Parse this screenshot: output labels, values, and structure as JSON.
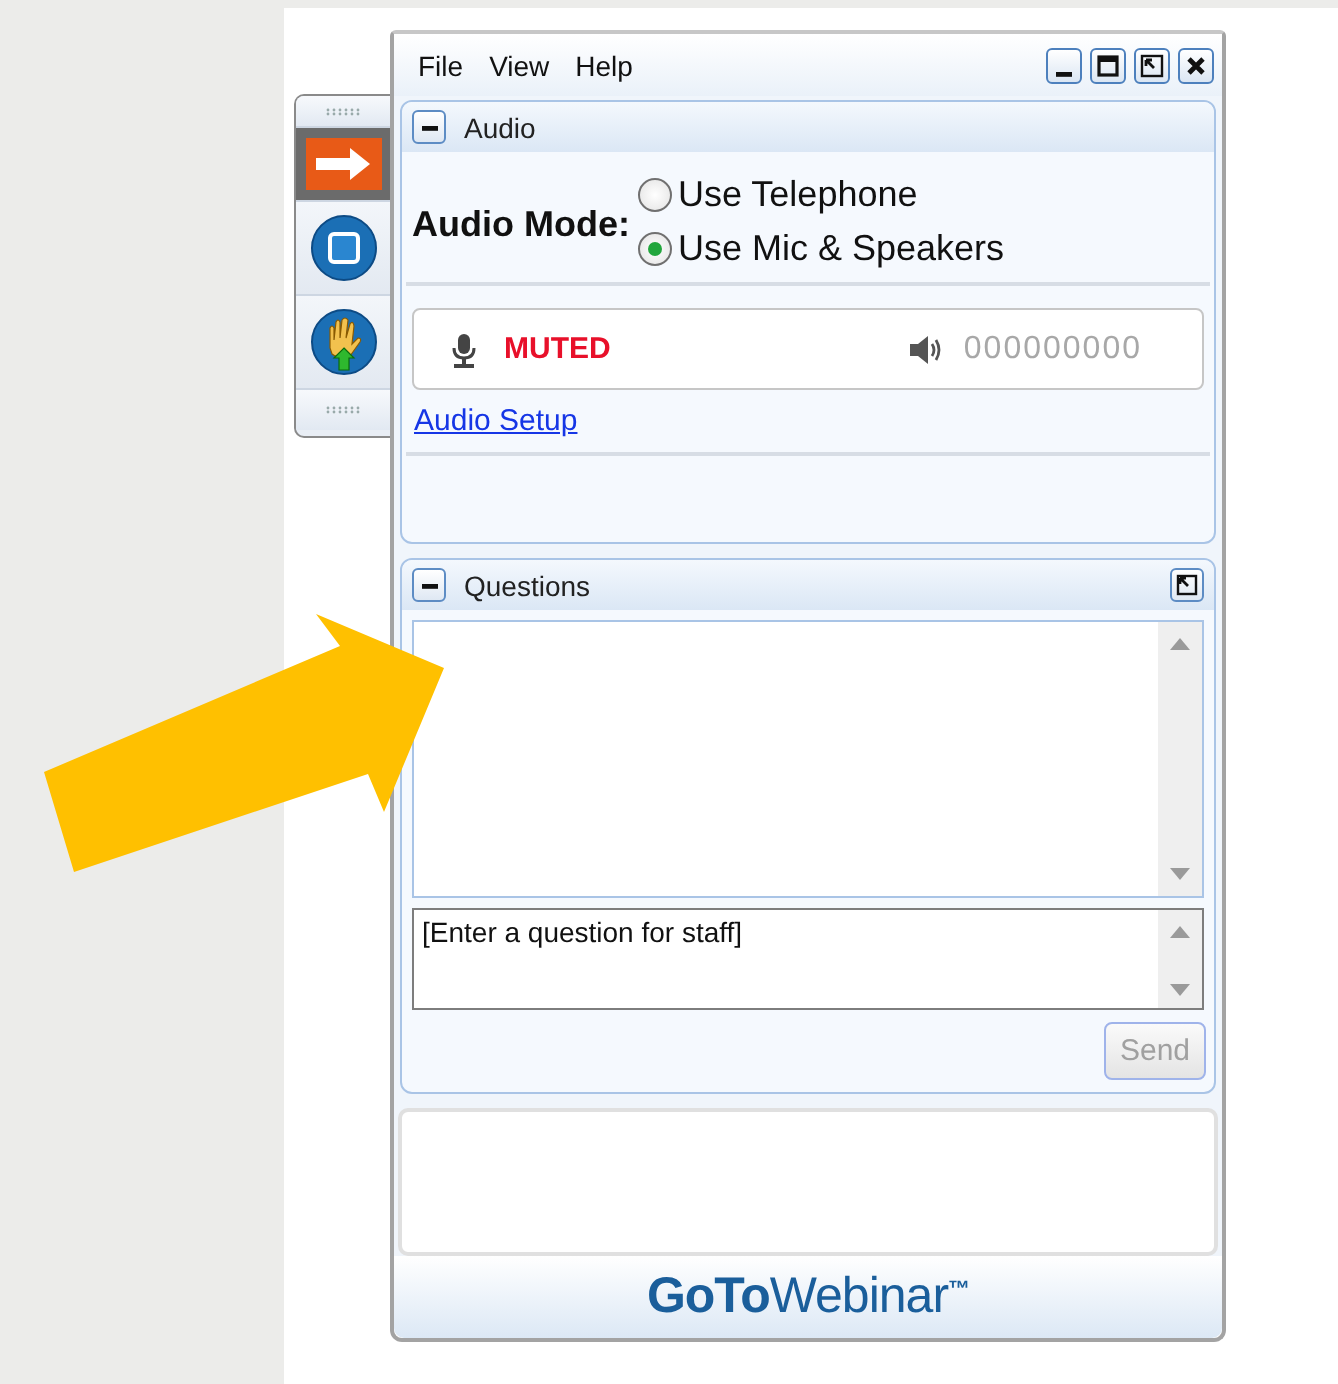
{
  "menu": [
    {
      "label": "File"
    },
    {
      "label": "View"
    },
    {
      "label": "Help"
    }
  ],
  "audio": {
    "title": "Audio",
    "expanded": true,
    "mode_label": "Audio Mode:",
    "options": [
      {
        "label": "Use Telephone",
        "selected": false
      },
      {
        "label": "Use Mic & Speakers",
        "selected": true
      }
    ],
    "mic_status": "MUTED",
    "pin": "000000000",
    "setup_link": "Audio Setup"
  },
  "questions": {
    "title": "Questions",
    "expanded": true,
    "input": {
      "placeholder": "[Enter a question for staff]"
    },
    "send_button": {
      "label": "Send",
      "disabled": true
    }
  },
  "brand": "**GoTo**Webinar$^{™}$"
}
